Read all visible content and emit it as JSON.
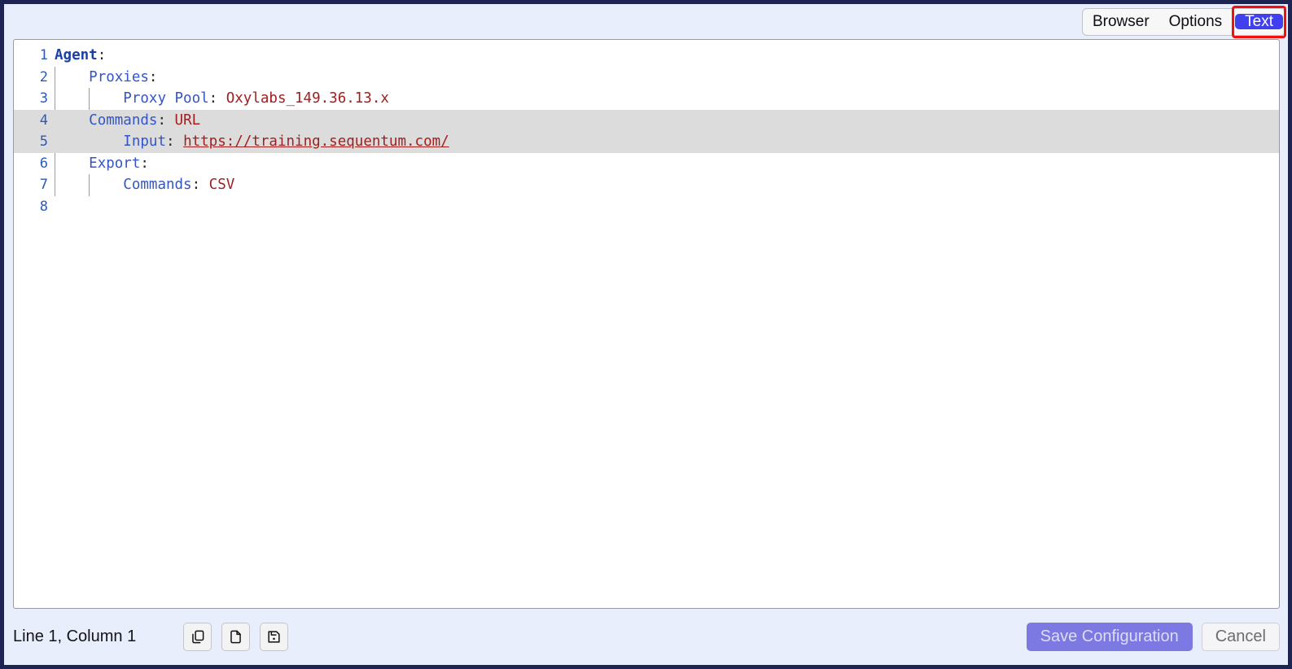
{
  "view_toggle": {
    "options": [
      {
        "label": "Browser",
        "active": false
      },
      {
        "label": "Options",
        "active": false
      },
      {
        "label": "Text",
        "active": true
      }
    ],
    "active_value": "Text",
    "annotation_color": "#f20f0f",
    "active_color": "#4040ee"
  },
  "editor": {
    "language": "yaml",
    "highlighted_lines": [
      4,
      5
    ],
    "lines": [
      {
        "number": "1",
        "indent_guides": 0,
        "tokens": [
          {
            "text": "Agent",
            "type": "root"
          },
          {
            "text": ":",
            "type": "punct"
          }
        ]
      },
      {
        "number": "2",
        "indent_guides": 1,
        "tokens": [
          {
            "text": "    ",
            "type": "plain"
          },
          {
            "text": "Proxies",
            "type": "key"
          },
          {
            "text": ":",
            "type": "punct"
          }
        ]
      },
      {
        "number": "3",
        "indent_guides": 2,
        "tokens": [
          {
            "text": "        ",
            "type": "plain"
          },
          {
            "text": "Proxy Pool",
            "type": "key"
          },
          {
            "text": ": ",
            "type": "punct"
          },
          {
            "text": "Oxylabs_149.36.13.x",
            "type": "val"
          }
        ]
      },
      {
        "number": "4",
        "indent_guides": 0,
        "tokens": [
          {
            "text": "    ",
            "type": "plain"
          },
          {
            "text": "Commands",
            "type": "key"
          },
          {
            "text": ": ",
            "type": "punct"
          },
          {
            "text": "URL",
            "type": "val"
          }
        ]
      },
      {
        "number": "5",
        "indent_guides": 0,
        "tokens": [
          {
            "text": "        ",
            "type": "plain"
          },
          {
            "text": "Input",
            "type": "key"
          },
          {
            "text": ": ",
            "type": "punct"
          },
          {
            "text": "https://training.sequentum.com/",
            "type": "link"
          }
        ]
      },
      {
        "number": "6",
        "indent_guides": 1,
        "tokens": [
          {
            "text": "    ",
            "type": "plain"
          },
          {
            "text": "Export",
            "type": "key"
          },
          {
            "text": ":",
            "type": "punct"
          }
        ]
      },
      {
        "number": "7",
        "indent_guides": 2,
        "tokens": [
          {
            "text": "        ",
            "type": "plain"
          },
          {
            "text": "Commands",
            "type": "key"
          },
          {
            "text": ": ",
            "type": "punct"
          },
          {
            "text": "CSV",
            "type": "val"
          }
        ]
      },
      {
        "number": "8",
        "indent_guides": 0,
        "tokens": []
      }
    ]
  },
  "footer": {
    "status": "Line 1, Column 1",
    "cursor_line": 1,
    "cursor_column": 1,
    "icon_buttons": [
      {
        "name": "copy-icon",
        "title": "Copy"
      },
      {
        "name": "new-file-icon",
        "title": "New File"
      },
      {
        "name": "save-file-icon",
        "title": "Save File"
      }
    ],
    "save_label": "Save Configuration",
    "save_enabled": false,
    "cancel_label": "Cancel",
    "save_color": "#7c7ae2"
  }
}
